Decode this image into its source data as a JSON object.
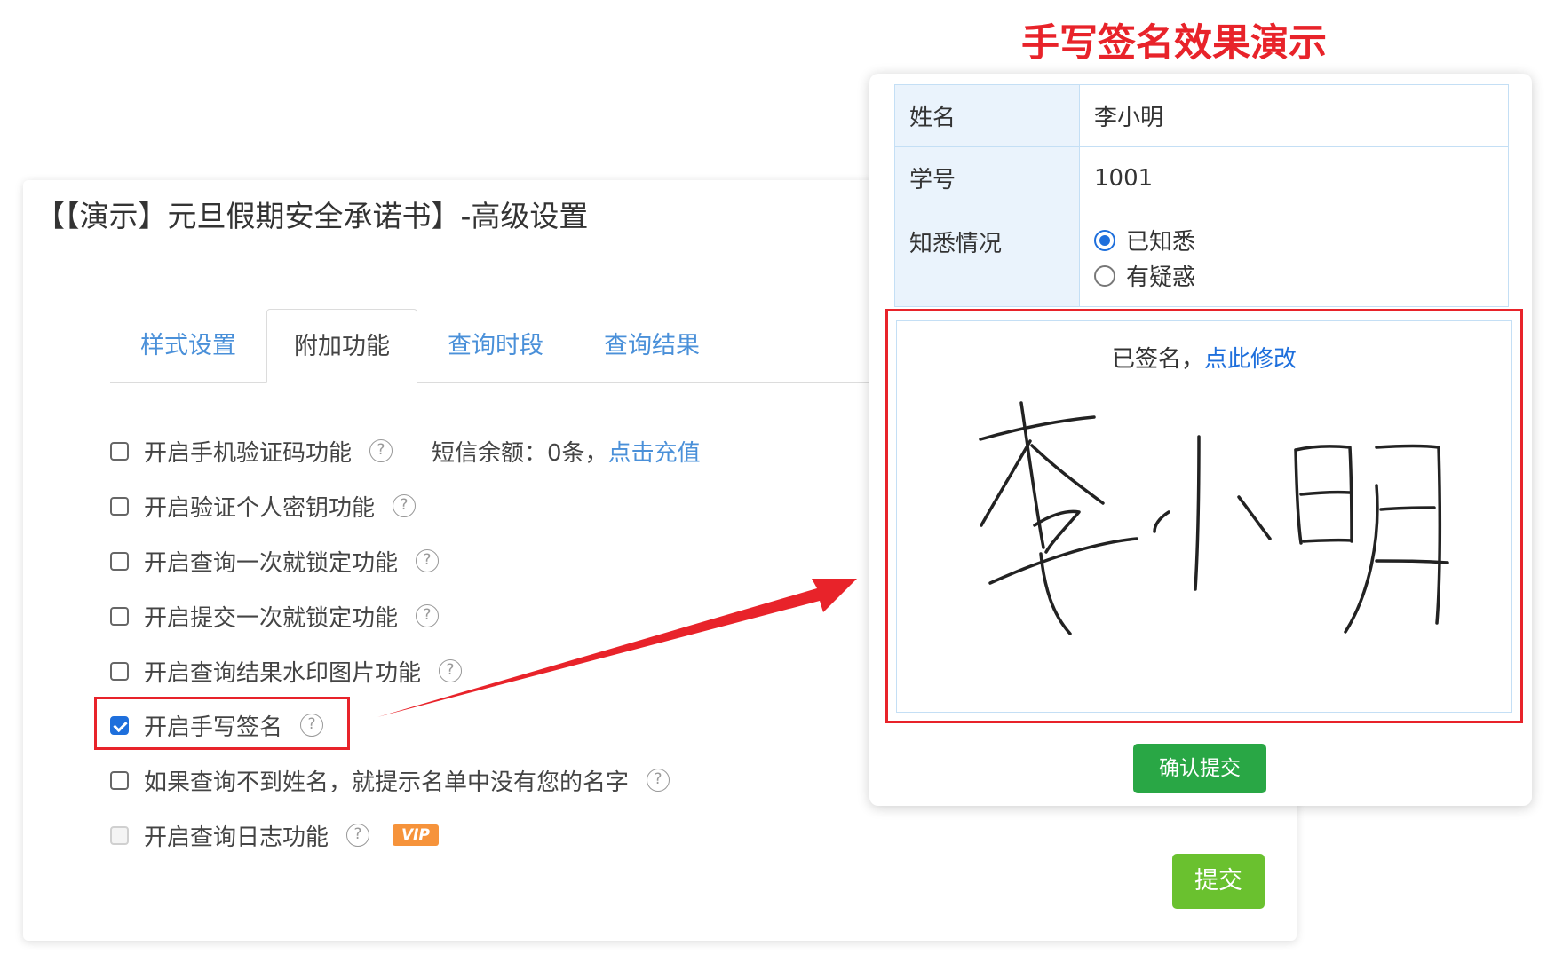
{
  "settings": {
    "title": "【【演示】元旦假期安全承诺书】-高级设置",
    "tabs": [
      {
        "label": "样式设置"
      },
      {
        "label": "附加功能"
      },
      {
        "label": "查询时段"
      },
      {
        "label": "查询结果"
      }
    ],
    "active_tab": "附加功能",
    "options": [
      {
        "label": "开启手机验证码功能",
        "checked": false
      },
      {
        "label": "开启验证个人密钥功能",
        "checked": false
      },
      {
        "label": "开启查询一次就锁定功能",
        "checked": false
      },
      {
        "label": "开启提交一次就锁定功能",
        "checked": false
      },
      {
        "label": "开启查询结果水印图片功能",
        "checked": false
      },
      {
        "label": "开启手写签名",
        "checked": true
      },
      {
        "label": "如果查询不到姓名，就提示名单中没有您的名字",
        "checked": false
      },
      {
        "label": "开启查询日志功能",
        "checked": false,
        "disabled": true
      }
    ],
    "sms_balance_text": "短信余额：0条，",
    "recharge_link": "点击充值",
    "vip_badge": "VIP",
    "help_glyph": "?",
    "submit_label": "提交"
  },
  "demo": {
    "title": "手写签名效果演示",
    "rows": [
      {
        "label": "姓名",
        "value": "李小明"
      },
      {
        "label": "学号",
        "value": "1001"
      },
      {
        "label": "知悉情况"
      }
    ],
    "radio_options": [
      {
        "label": "已知悉",
        "selected": true
      },
      {
        "label": "有疑惑",
        "selected": false
      }
    ],
    "signed_text": "已签名，",
    "modify_link": "点此修改",
    "confirm_label": "确认提交"
  },
  "colors": {
    "accent_red": "#e8232a",
    "link_blue": "#4a90d9",
    "submit_green": "#6ac12f",
    "confirm_green": "#29a745",
    "vip_orange": "#f6933b"
  }
}
